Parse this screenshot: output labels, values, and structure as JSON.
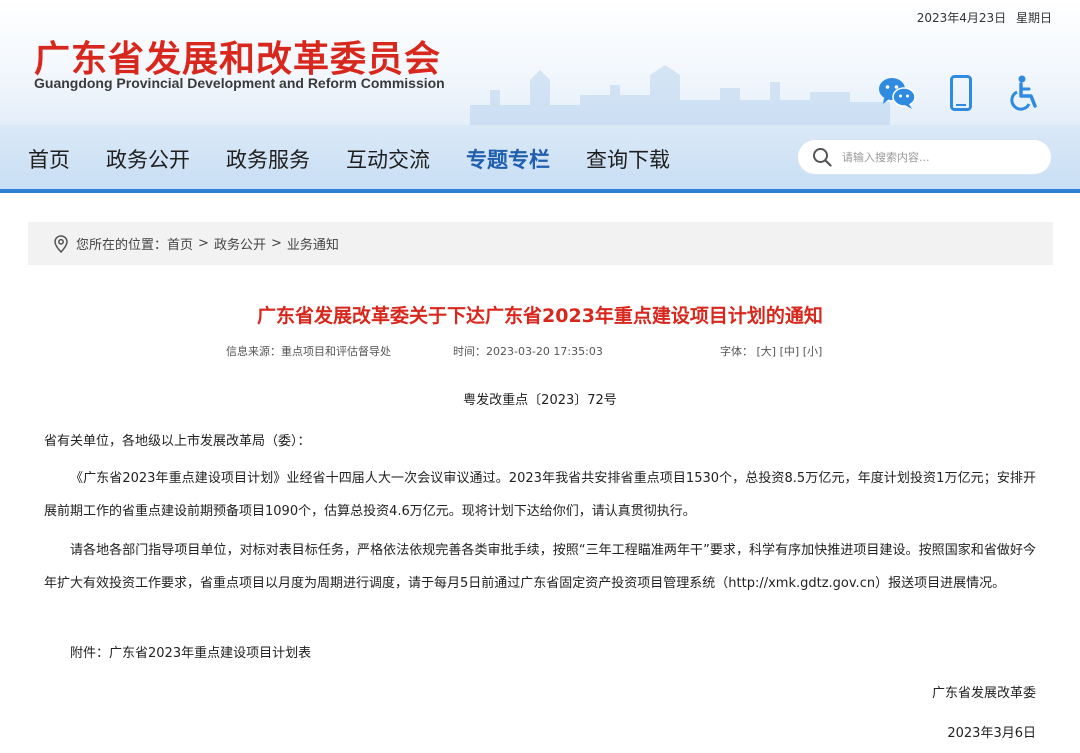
{
  "header": {
    "date": "2023年4月23日",
    "weekday": "星期日",
    "logo_cn": "广东省发展和改革委员会",
    "logo_en": "Guangdong Provincial Development and Reform Commission",
    "icons": [
      "wechat-icon",
      "mobile-icon",
      "accessibility-icon"
    ]
  },
  "nav": {
    "items": [
      {
        "label": "首页",
        "active": false
      },
      {
        "label": "政务公开",
        "active": false
      },
      {
        "label": "政务服务",
        "active": false
      },
      {
        "label": "互动交流",
        "active": false
      },
      {
        "label": "专题专栏",
        "active": true
      },
      {
        "label": "查询下载",
        "active": false
      }
    ],
    "search_placeholder": "请输入搜索内容..."
  },
  "breadcrumb": {
    "prefix": "您所在的位置：",
    "items": [
      "首页",
      "政务公开",
      "业务通知"
    ],
    "separator": ">"
  },
  "article": {
    "title": "广东省发展改革委关于下达广东省2023年重点建设项目计划的通知",
    "source": "信息来源：重点项目和评估督导处",
    "time": "时间：2023-03-20 17:35:03",
    "font_label": "字体：",
    "font_sizes": [
      "[大]",
      "[中]",
      "[小]"
    ],
    "doc_no": "粤发改重点〔2023〕72号",
    "addressee": "省有关单位，各地级以上市发展改革局（委）：",
    "para1": "《广东省2023年重点建设项目计划》业经省十四届人大一次会议审议通过。2023年我省共安排省重点项目1530个，总投资8.5万亿元，年度计划投资1万亿元；安排开展前期工作的省重点建设前期预备项目1090个，估算总投资4.6万亿元。现将计划下达给你们，请认真贯彻执行。",
    "para2": "请各地各部门指导项目单位，对标对表目标任务，严格依法依规完善各类审批手续，按照“三年工程瞄准两年干”要求，科学有序加快推进项目建设。按照国家和省做好今年扩大有效投资工作要求，省重点项目以月度为周期进行调度，请于每月5日前通过广东省固定资产投资项目管理系统（http://xmk.gdtz.gov.cn）报送项目进展情况。",
    "attachment": "附件：广东省2023年重点建设项目计划表",
    "signature": "广东省发展改革委",
    "sign_date": "2023年3月6日"
  },
  "colors": {
    "brand_red": "#d8271c",
    "nav_blue": "#2d7fd3",
    "active_nav": "#1f5fae",
    "icon_blue": "#2f8be0"
  }
}
